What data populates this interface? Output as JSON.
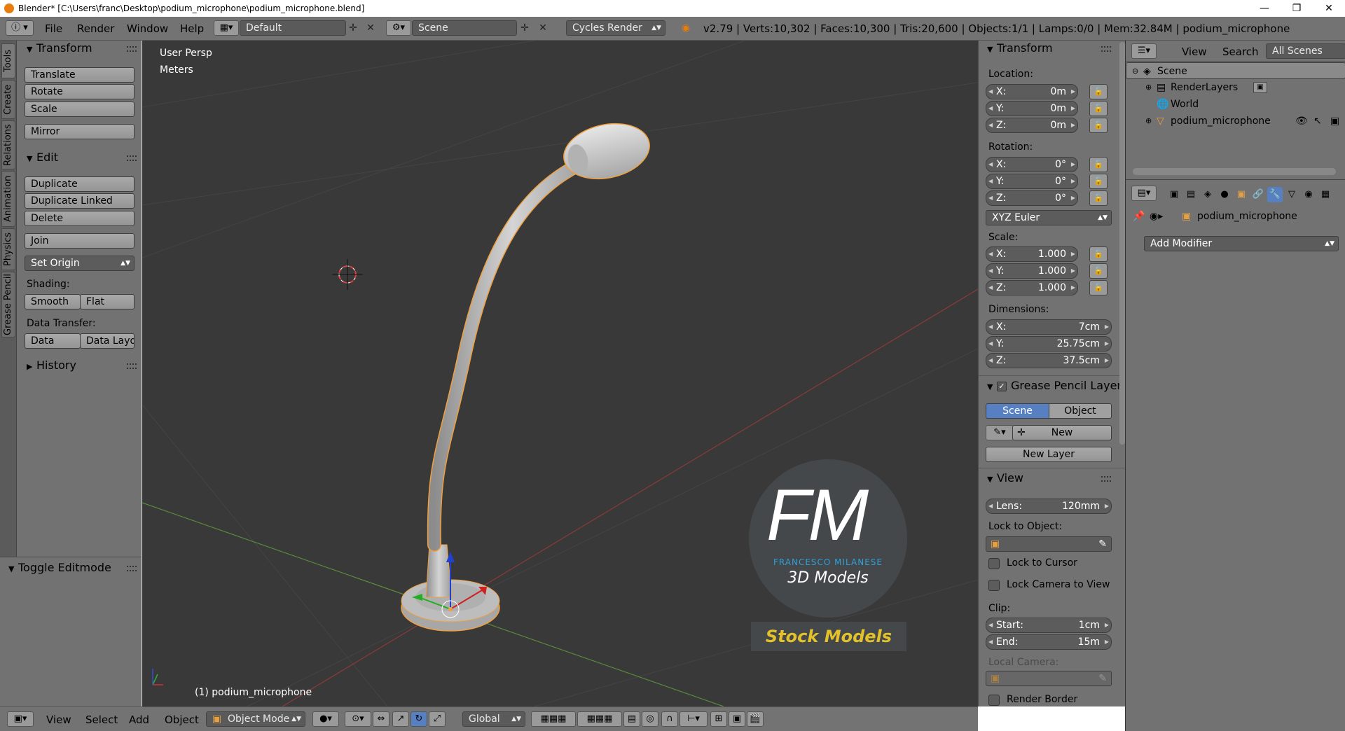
{
  "window": {
    "title": "Blender* [C:\\Users\\franc\\Desktop\\podium_microphone\\podium_microphone.blend]",
    "controls": [
      "—",
      "❐",
      "✕"
    ]
  },
  "topbar": {
    "menus": [
      "File",
      "Render",
      "Window",
      "Help"
    ],
    "screen_layout": "Default",
    "scene": "Scene",
    "render_engine": "Cycles Render",
    "stats": "v2.79 | Verts:10,302 | Faces:10,300 | Tris:20,600 | Objects:1/1 | Lamps:0/0 | Mem:32.84M | podium_microphone"
  },
  "left_tabs": [
    "Tools",
    "Create",
    "Relations",
    "Animation",
    "Physics",
    "Grease Pencil"
  ],
  "toolshelf": {
    "transform": {
      "title": "Transform",
      "buttons": [
        "Translate",
        "Rotate",
        "Scale",
        "Mirror"
      ]
    },
    "edit": {
      "title": "Edit",
      "buttons": [
        "Duplicate",
        "Duplicate Linked",
        "Delete",
        "Join"
      ],
      "set_origin": "Set Origin",
      "shading_label": "Shading:",
      "shading": [
        "Smooth",
        "Flat"
      ],
      "data_transfer_label": "Data Transfer:",
      "data_transfer": [
        "Data",
        "Data Layo"
      ]
    },
    "history": "History",
    "toggle_editmode": "Toggle Editmode"
  },
  "viewport": {
    "view_name": "User Persp",
    "units": "Meters",
    "active_object": "(1) podium_microphone",
    "watermark": {
      "logo": "FM",
      "name": "FRANCESCO MILANESE",
      "subtitle": "3D Models",
      "banner": "Stock Models"
    }
  },
  "bottombar": {
    "menus": [
      "View",
      "Select",
      "Add",
      "Object"
    ],
    "mode": "Object Mode",
    "orientation": "Global"
  },
  "npanel": {
    "transform_title": "Transform",
    "location_label": "Location:",
    "location": [
      {
        "k": "X:",
        "v": "0m"
      },
      {
        "k": "Y:",
        "v": "0m"
      },
      {
        "k": "Z:",
        "v": "0m"
      }
    ],
    "rotation_label": "Rotation:",
    "rotation": [
      {
        "k": "X:",
        "v": "0°"
      },
      {
        "k": "Y:",
        "v": "0°"
      },
      {
        "k": "Z:",
        "v": "0°"
      }
    ],
    "rotation_mode": "XYZ Euler",
    "scale_label": "Scale:",
    "scale": [
      {
        "k": "X:",
        "v": "1.000"
      },
      {
        "k": "Y:",
        "v": "1.000"
      },
      {
        "k": "Z:",
        "v": "1.000"
      }
    ],
    "dimensions_label": "Dimensions:",
    "dimensions": [
      {
        "k": "X:",
        "v": "7cm"
      },
      {
        "k": "Y:",
        "v": "25.75cm"
      },
      {
        "k": "Z:",
        "v": "37.5cm"
      }
    ],
    "grease_title": "Grease Pencil Layer",
    "grease_tabs": [
      "Scene",
      "Object"
    ],
    "grease_new": "New",
    "new_layer": "New Layer",
    "view_title": "View",
    "lens_k": "Lens:",
    "lens_v": "120mm",
    "lock_to_object": "Lock to Object:",
    "lock_cursor": "Lock to Cursor",
    "lock_camera": "Lock Camera to View",
    "clip_label": "Clip:",
    "clip_start_k": "Start:",
    "clip_start_v": "1cm",
    "clip_end_k": "End:",
    "clip_end_v": "15m",
    "local_camera": "Local Camera:",
    "render_border": "Render Border"
  },
  "outliner": {
    "menus": [
      "View",
      "Search"
    ],
    "filter": "All Scenes",
    "rows": [
      "Scene",
      "RenderLayers",
      "World",
      "podium_microphone"
    ]
  },
  "properties": {
    "object": "podium_microphone",
    "add_modifier": "Add Modifier"
  },
  "colors": {
    "accent_blue": "#4f7fc9",
    "selection_orange": "#f0a040",
    "viewport_bg": "#393939"
  }
}
